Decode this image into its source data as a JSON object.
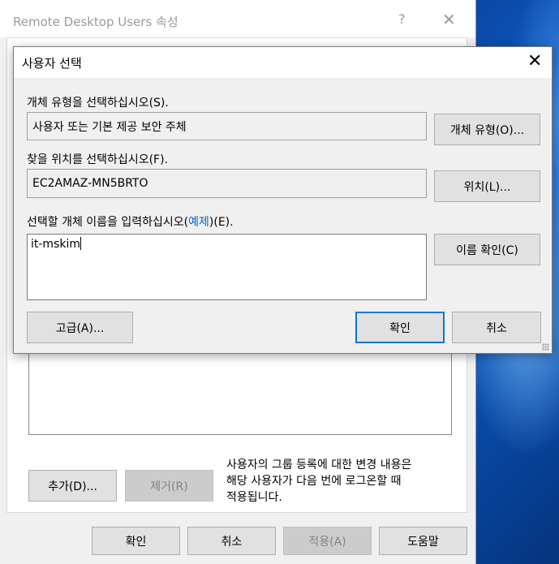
{
  "parent_window": {
    "title": "Remote Desktop Users 속성",
    "help_glyph": "?",
    "close_glyph": "✕",
    "add_button": "추가(D)...",
    "remove_button": "제거(R)",
    "note": "사용자의 그룹 등록에 대한 변경 내용은\n해당 사용자가 다음 번에 로그온할 때\n적용됩니다.",
    "ok_button": "확인",
    "cancel_button": "취소",
    "apply_button": "적용(A)",
    "help_button": "도움말"
  },
  "dialog": {
    "title": "사용자 선택",
    "close_glyph": "✕",
    "object_type_label": "개체 유형을 선택하십시오(S).",
    "object_type_value": "사용자 또는 기본 제공 보안 주체",
    "object_type_button": "개체 유형(O)...",
    "location_label": "찾을 위치를 선택하십시오(F).",
    "location_value": "EC2AMAZ-MN5BRTO",
    "location_button": "위치(L)...",
    "name_label_prefix": "선택할 개체 이름을 입력하십시오(",
    "name_label_link": "예제",
    "name_label_suffix": ")(E).",
    "name_value": "it-mskim",
    "check_names_button": "이름 확인(C)",
    "advanced_button": "고급(A)...",
    "ok_button": "확인",
    "cancel_button": "취소"
  }
}
